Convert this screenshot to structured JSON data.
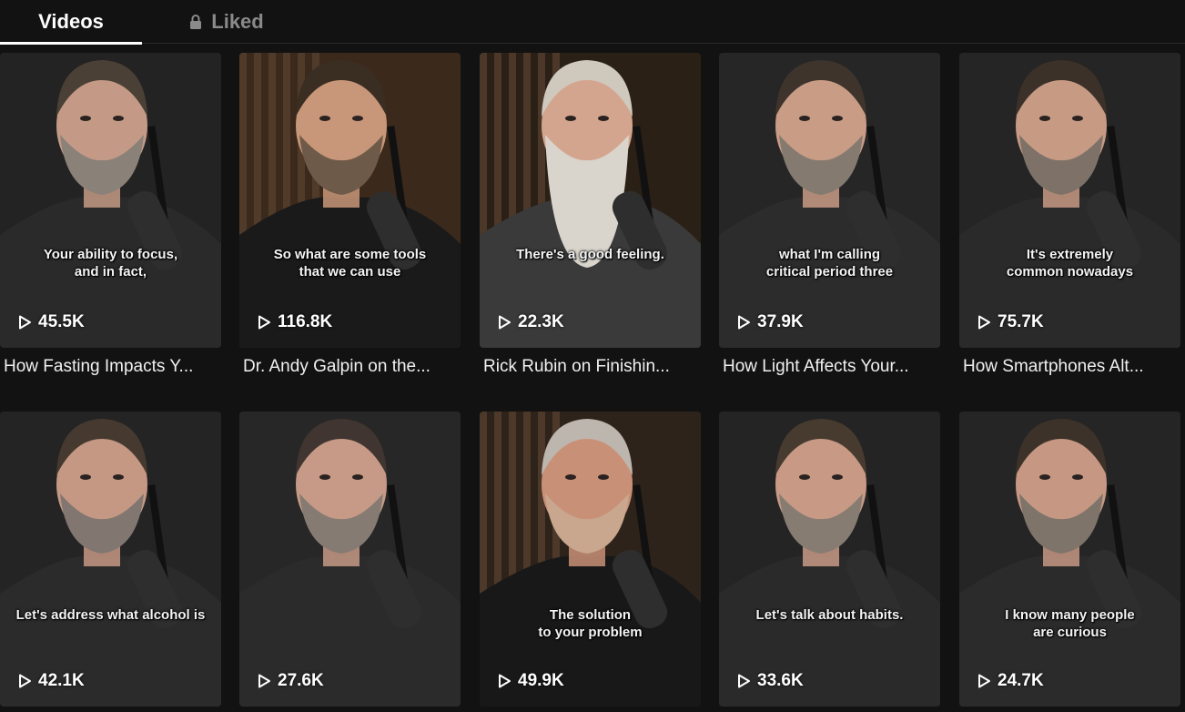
{
  "tabs": {
    "videos_label": "Videos",
    "liked_label": "Liked",
    "active": "Videos"
  },
  "videos": [
    {
      "caption": "Your ability to focus,\nand in fact,",
      "views": "45.5K",
      "title": "How Fasting Impacts Y...",
      "bg": "#232323",
      "stripes": false,
      "beard": "#8a8178",
      "hair": "#4a4036",
      "shirt": "#2a2a2a",
      "skin": "#c49a86"
    },
    {
      "caption": "So what are some tools\nthat we can use",
      "views": "116.8K",
      "title": "Dr. Andy Galpin on the...",
      "bg": "#3b2a1c",
      "stripes": true,
      "beard": "#6e5a48",
      "hair": "#3a2d22",
      "shirt": "#1a1a1a",
      "skin": "#c89678"
    },
    {
      "caption": "There's a good feeling.",
      "views": "22.3K",
      "title": "Rick Rubin on Finishin...",
      "bg": "#2b2016",
      "stripes": true,
      "beard": "#d9d4cc",
      "hair": "#cfc8bd",
      "shirt": "#3a3a3a",
      "skin": "#d4a58e"
    },
    {
      "caption": "what I'm calling\ncritical period three",
      "views": "37.9K",
      "title": "How Light Affects Your...",
      "bg": "#262626",
      "stripes": false,
      "beard": "#857a70",
      "hair": "#3e342c",
      "shirt": "#2c2c2c",
      "skin": "#c99c86"
    },
    {
      "caption": "It's extremely\ncommon nowadays",
      "views": "75.7K",
      "title": "How Smartphones Alt...",
      "bg": "#252525",
      "stripes": false,
      "beard": "#7e7268",
      "hair": "#3c3128",
      "shirt": "#2a2a2a",
      "skin": "#c79a84"
    },
    {
      "caption": "Let's address what alcohol is",
      "views": "42.1K",
      "title": "",
      "bg": "#242424",
      "stripes": false,
      "beard": "#827670",
      "hair": "#463a30",
      "shirt": "#2b2b2b",
      "skin": "#c59884"
    },
    {
      "caption": "",
      "views": "27.6K",
      "title": "",
      "bg": "#272727",
      "stripes": false,
      "beard": "#867b72",
      "hair": "#403530",
      "shirt": "#2b2b2b",
      "skin": "#c69a86"
    },
    {
      "caption": "The solution\nto your problem",
      "views": "49.9K",
      "title": "",
      "bg": "#2e231a",
      "stripes": true,
      "beard": "#c9a78e",
      "hair": "#bdb6ae",
      "shirt": "#181818",
      "skin": "#c99078"
    },
    {
      "caption": "Let's talk about habits.",
      "views": "33.6K",
      "title": "",
      "bg": "#242424",
      "stripes": false,
      "beard": "#877c72",
      "hair": "#473b30",
      "shirt": "#2a2a2a",
      "skin": "#c89a86"
    },
    {
      "caption": "I know many people\nare curious",
      "views": "24.7K",
      "title": "",
      "bg": "#252525",
      "stripes": false,
      "beard": "#7f746a",
      "hair": "#3d3229",
      "shirt": "#2b2b2b",
      "skin": "#c69884"
    }
  ],
  "icons": {
    "lock": "lock-icon",
    "play": "play-icon"
  }
}
